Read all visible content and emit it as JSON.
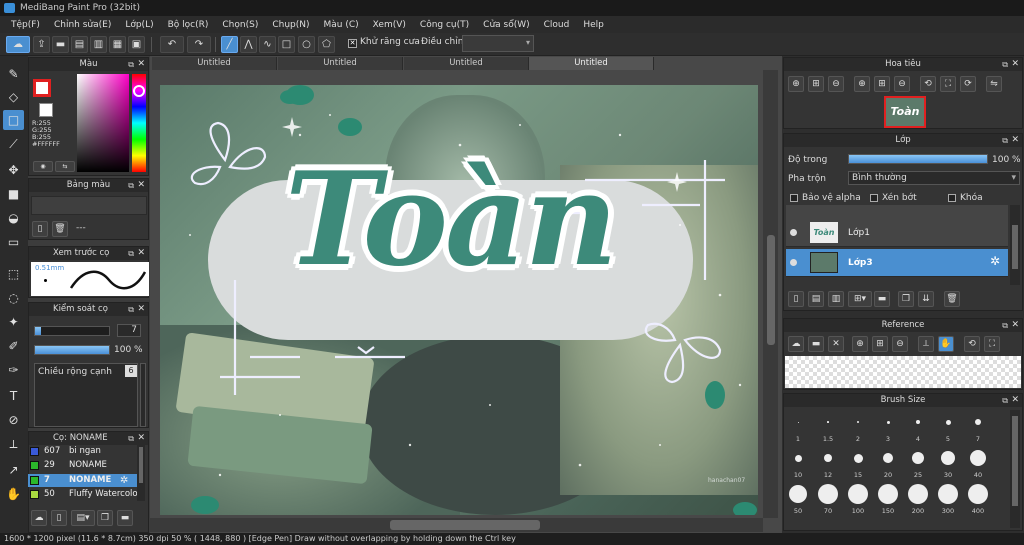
{
  "window": {
    "title": "MediBang Paint Pro (32bit)"
  },
  "menu": [
    "Tệp(F)",
    "Chỉnh sửa(E)",
    "Lớp(L)",
    "Bộ lọc(R)",
    "Chọn(S)",
    "Chụp(N)",
    "Màu (C)",
    "Xem(V)",
    "Công cụ(T)",
    "Cửa sổ(W)",
    "Cloud",
    "Help"
  ],
  "toolbar": {
    "antialias_label": "Khử răng cưa",
    "antialias_checked": "✕",
    "adjust_label": "Điều chỉnh"
  },
  "tabs": [
    "Untitled",
    "Untitled",
    "Untitled",
    "Untitled"
  ],
  "color_panel": {
    "title": "Màu",
    "r": "R:255",
    "g": "G:255",
    "b": "B:255",
    "hex": "#FFFFFF"
  },
  "palette_panel": {
    "title": "Bảng màu",
    "dash": "---"
  },
  "brush_preview_panel": {
    "title": "Xem trước cọ",
    "size": "0.51mm"
  },
  "brush_control_panel": {
    "title": "Kiểm soát cọ",
    "size_value": "7",
    "opacity_value": "100 %",
    "width_label": "Chiều rộng cạnh",
    "width_value": "6"
  },
  "brush_list_panel": {
    "title": "Cọ: NONAME",
    "items": [
      {
        "size": "607",
        "name": "bi ngan",
        "color": "#3a5ad8"
      },
      {
        "size": "29",
        "name": "NONAME",
        "color": "#2bb82b"
      },
      {
        "size": "7",
        "name": "NONAME",
        "color": "#2bb82b"
      },
      {
        "size": "50",
        "name": "Fluffy Watercolor",
        "color": "#a8d840"
      }
    ]
  },
  "artwork": {
    "title_text": "Toàn",
    "signature": "hanachan07"
  },
  "navigator_panel": {
    "title": "Hoa tiêu",
    "thumb_text": "Toàn"
  },
  "layer_panel": {
    "title": "Lớp",
    "opacity_label": "Độ trong",
    "opacity_value": "100 %",
    "opacity_level": 1.0,
    "blend_label": "Pha trộn",
    "blend_value": "Bình thường",
    "protect_alpha": "Bảo vệ alpha",
    "clipping": "Xén bớt",
    "lock": "Khóa",
    "layers": [
      {
        "name": "Lớp1",
        "thumb": "Toàn"
      },
      {
        "name": "Lớp3"
      }
    ]
  },
  "reference_panel": {
    "title": "Reference"
  },
  "brush_size_panel": {
    "title": "Brush Size",
    "sizes": [
      "1",
      "1.5",
      "2",
      "3",
      "4",
      "5",
      "7",
      "10",
      "12",
      "15",
      "20",
      "25",
      "30",
      "40",
      "50",
      "70",
      "100",
      "150",
      "200",
      "300",
      "400"
    ]
  },
  "statusbar": {
    "text": "1600 * 1200 pixel   (11.6 * 8.7cm)  350 dpi   50 %   ( 1448, 880 )   [Edge Pen] Draw without overlapping by holding down the Ctrl key"
  },
  "colors": {
    "accent": "#4a8fd0",
    "panel": "#343434",
    "title_teal": "#3d8a7a"
  }
}
